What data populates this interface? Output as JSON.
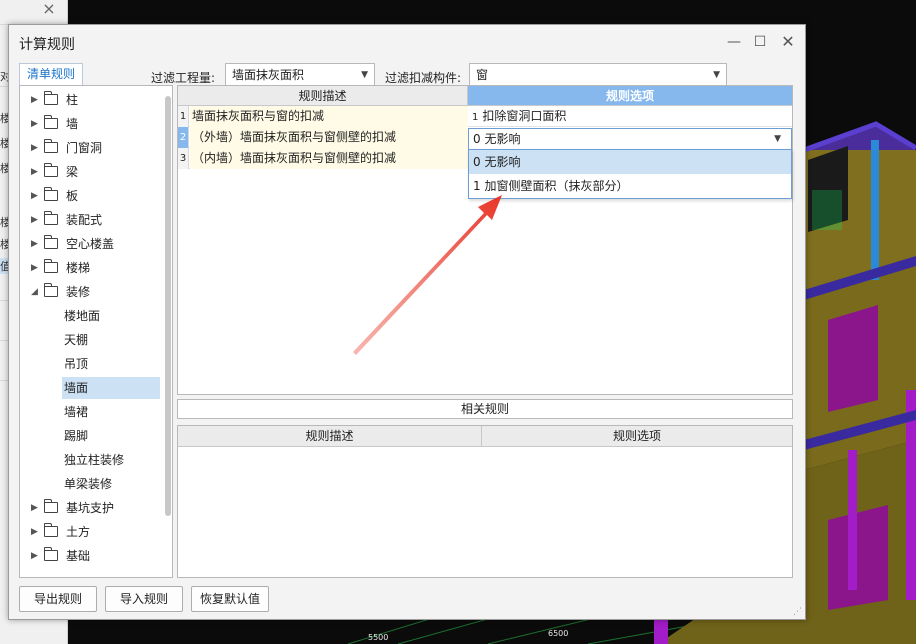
{
  "background": {
    "left_panel_fragments": [
      "对",
      "楼",
      "楼",
      "楼",
      "楼",
      "楼",
      "值"
    ]
  },
  "dialog": {
    "title": "计算规则",
    "tab_label": "清单规则",
    "filter_quantity_label": "过滤工程量:",
    "filter_quantity_value": "墙面抹灰面积",
    "filter_component_label": "过滤扣减构件:",
    "filter_component_value": "窗"
  },
  "tree": {
    "nodes": [
      {
        "label": "柱",
        "expanded": false
      },
      {
        "label": "墙",
        "expanded": false
      },
      {
        "label": "门窗洞",
        "expanded": false
      },
      {
        "label": "梁",
        "expanded": false
      },
      {
        "label": "板",
        "expanded": false
      },
      {
        "label": "装配式",
        "expanded": false
      },
      {
        "label": "空心楼盖",
        "expanded": false
      },
      {
        "label": "楼梯",
        "expanded": false
      },
      {
        "label": "装修",
        "expanded": true
      }
    ],
    "children": [
      "楼地面",
      "天棚",
      "吊顶",
      "墙面",
      "墙裙",
      "踢脚",
      "独立柱装修",
      "单梁装修"
    ],
    "selected_child": "墙面",
    "after": [
      {
        "label": "基坑支护",
        "expanded": false
      },
      {
        "label": "土方",
        "expanded": false
      },
      {
        "label": "基础",
        "expanded": false
      }
    ]
  },
  "rules_grid": {
    "headers": [
      "规则描述",
      "规则选项"
    ],
    "rows": [
      {
        "num": "1",
        "desc": "墙面抹灰面积与窗的扣减",
        "option": "扣除窗洞口面积",
        "option_num": "1"
      },
      {
        "num": "2",
        "desc": "（外墙）墙面抹灰面积与窗侧壁的扣减",
        "option": "0  无影响",
        "option_num": ""
      },
      {
        "num": "3",
        "desc": "（内墙）墙面抹灰面积与窗侧壁的扣减",
        "option": "",
        "option_num": ""
      }
    ],
    "dropdown": [
      "0  无影响",
      "1 加窗侧壁面积（抹灰部分）"
    ]
  },
  "related": {
    "title": "相关规则",
    "headers": [
      "规则描述",
      "规则选项"
    ]
  },
  "buttons": {
    "export": "导出规则",
    "import": "导入规则",
    "restore": "恢复默认值"
  },
  "colors": {
    "accent": "#86b8ee",
    "selection": "#cde1f5",
    "desc_cell": "#fffbe6",
    "annotation_arrow": "#e8372a"
  }
}
